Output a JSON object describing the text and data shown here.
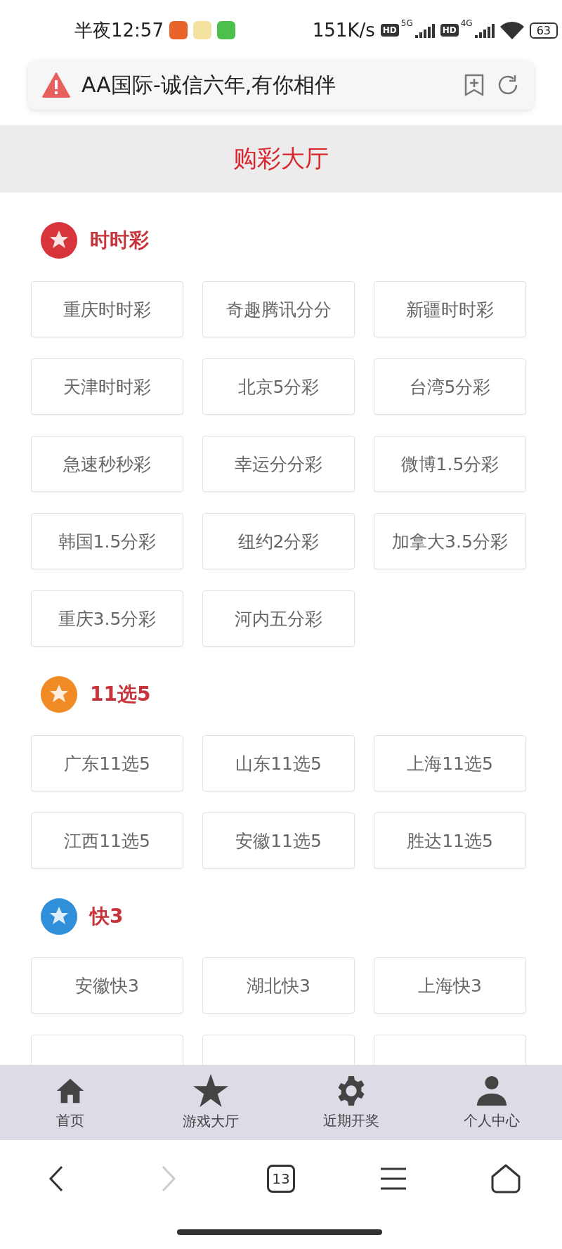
{
  "status_bar": {
    "time": "半夜12:57",
    "speed": "151K/s",
    "signals": [
      {
        "badge": "HD",
        "network": "5G"
      },
      {
        "badge": "HD",
        "network": "4G"
      }
    ],
    "battery": "63"
  },
  "address_bar": {
    "title": "AA国际-诚信六年,有你相伴"
  },
  "header": {
    "title": "购彩大厅"
  },
  "sections": [
    {
      "title": "时时彩",
      "color": "#d8343c",
      "games": [
        "重庆时时彩",
        "奇趣腾讯分分",
        "新疆时时彩",
        "天津时时彩",
        "北京5分彩",
        "台湾5分彩",
        "急速秒秒彩",
        "幸运分分彩",
        "微博1.5分彩",
        "韩国1.5分彩",
        "纽约2分彩",
        "加拿大3.5分彩",
        "重庆3.5分彩",
        "河内五分彩"
      ]
    },
    {
      "title": "11选5",
      "color": "#f08a24",
      "games": [
        "广东11选5",
        "山东11选5",
        "上海11选5",
        "江西11选5",
        "安徽11选5",
        "胜达11选5"
      ]
    },
    {
      "title": "快3",
      "color": "#2f8fd8",
      "games": [
        "安徽快3",
        "湖北快3",
        "上海快3"
      ],
      "more_rows_below": true
    }
  ],
  "tab_bar": [
    {
      "label": "首页",
      "kind": "home"
    },
    {
      "label": "游戏大厅",
      "kind": "star"
    },
    {
      "label": "近期开奖",
      "kind": "gear"
    },
    {
      "label": "个人中心",
      "kind": "person"
    }
  ],
  "browser_nav": {
    "back_enabled": true,
    "forward_enabled": false,
    "tab_count": "13"
  }
}
